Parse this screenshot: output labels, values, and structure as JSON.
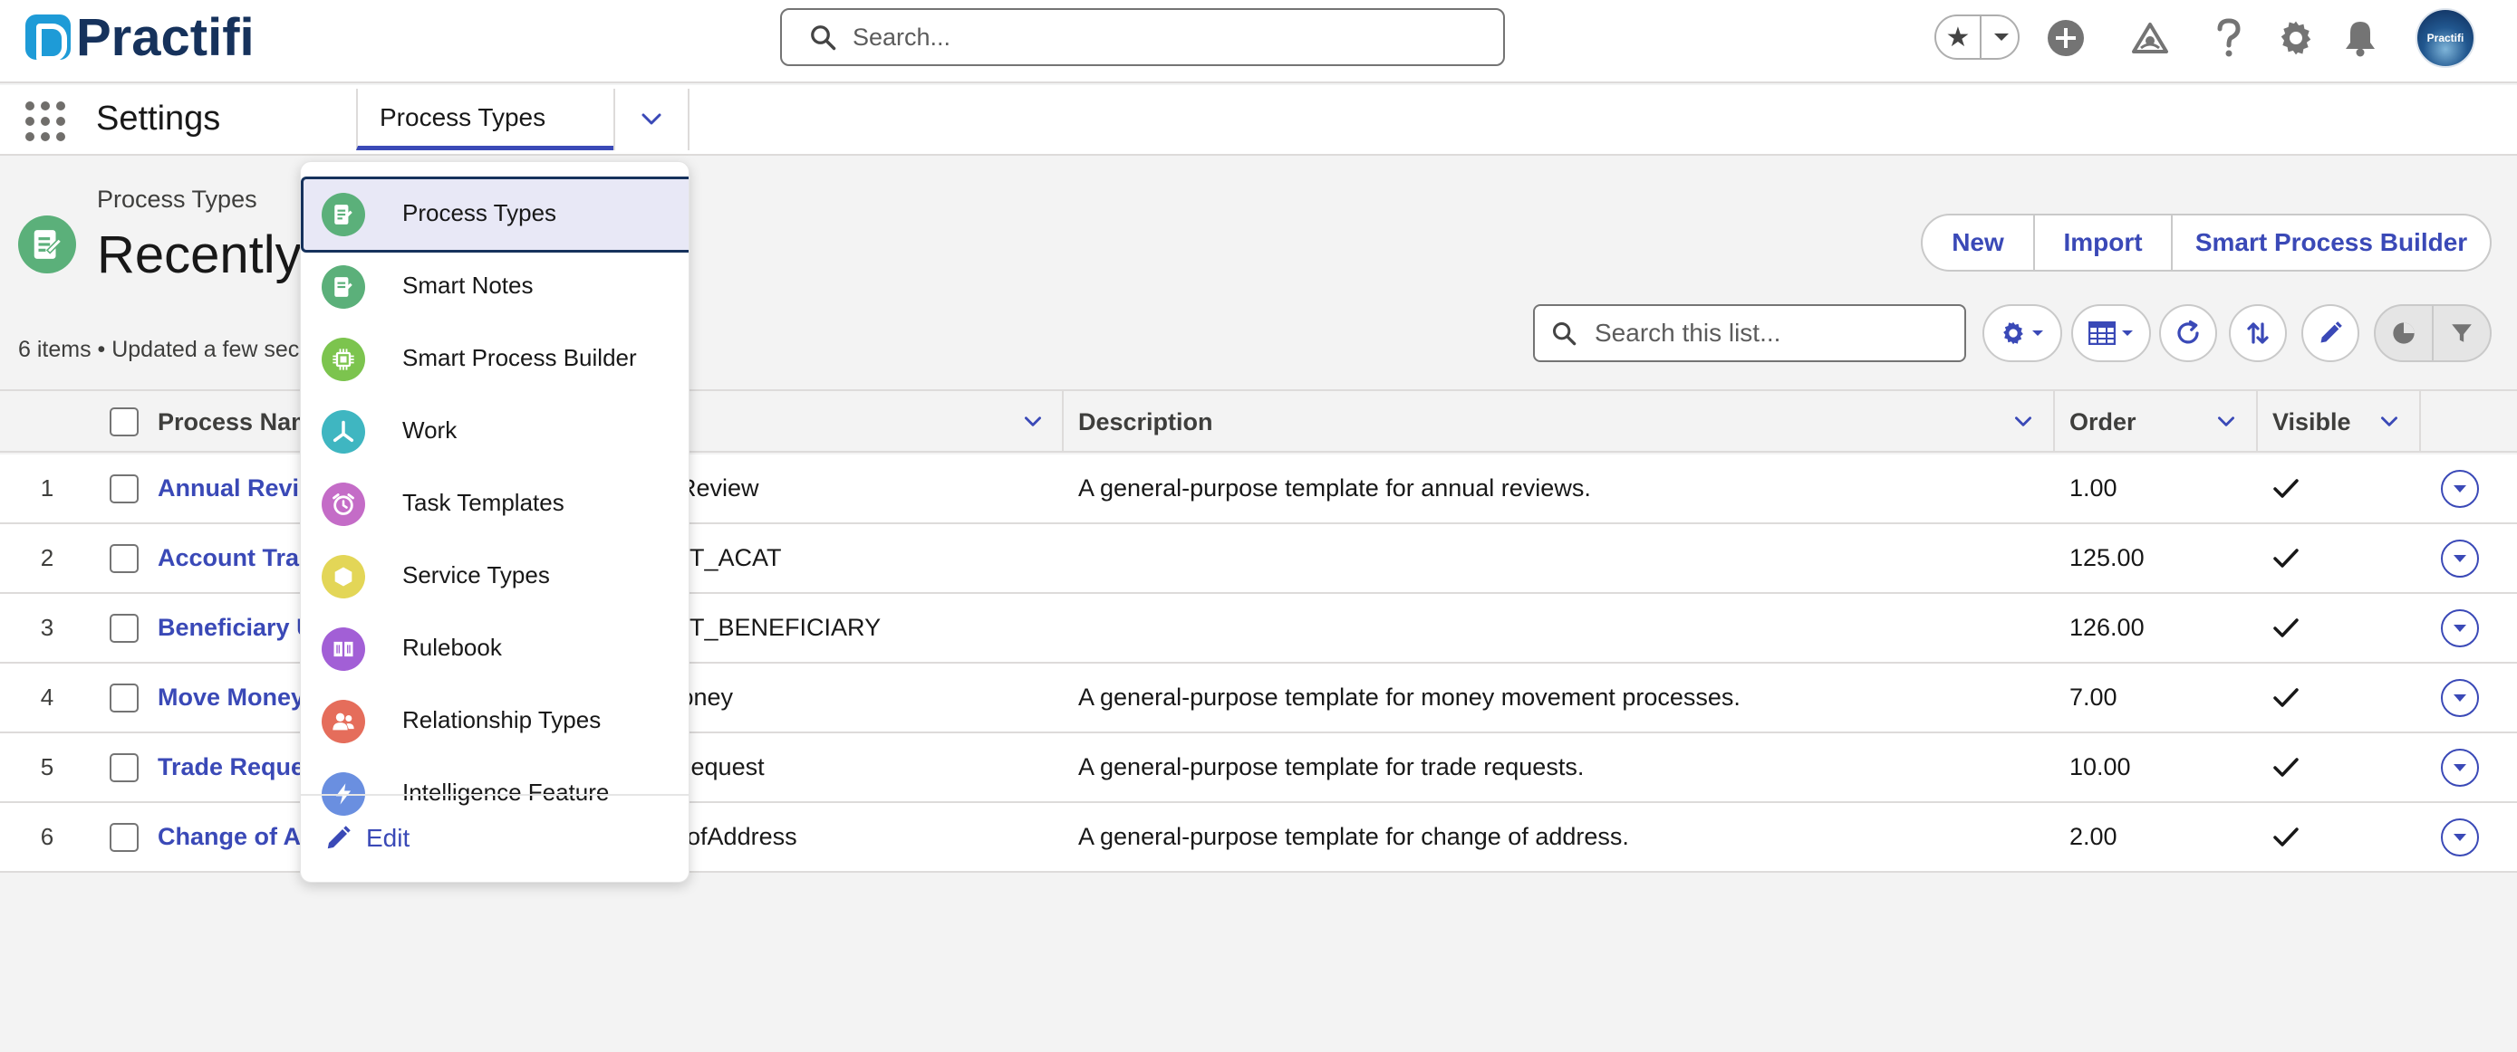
{
  "brand": {
    "name": "Practifi",
    "accent": "#3a49b7",
    "logo_color": "#1e9bd7"
  },
  "global_search": {
    "placeholder": "Search..."
  },
  "header_icons": [
    "favorites-star-icon",
    "chevron-down-icon",
    "add-icon",
    "trailhead-icon",
    "help-icon",
    "setup-gear-icon",
    "notifications-bell-icon"
  ],
  "avatar": {
    "label": "Practifi"
  },
  "nav": {
    "app_name": "Settings",
    "active_tab": "Process Types"
  },
  "dropdown": {
    "items": [
      {
        "label": "Process Types",
        "icon": "process-types-icon",
        "color": "#5bb07a",
        "selected": true
      },
      {
        "label": "Smart Notes",
        "icon": "smart-notes-icon",
        "color": "#5bb07a"
      },
      {
        "label": "Smart Process Builder",
        "icon": "chip-icon",
        "color": "#7cc44e"
      },
      {
        "label": "Work",
        "icon": "work-icon",
        "color": "#3fb6c1"
      },
      {
        "label": "Task Templates",
        "icon": "alarm-clock-icon",
        "color": "#c46cc7"
      },
      {
        "label": "Service Types",
        "icon": "hexagon-icon",
        "color": "#e3d657"
      },
      {
        "label": "Rulebook",
        "icon": "book-icon",
        "color": "#a25fd6"
      },
      {
        "label": "Relationship Types",
        "icon": "people-icon",
        "color": "#e56d5b"
      },
      {
        "label": "Intelligence Feature",
        "icon": "lightning-icon",
        "color": "#6a8fe0"
      }
    ],
    "edit_label": "Edit"
  },
  "page": {
    "object_label": "Process Types",
    "list_view_title": "Recently",
    "meta": "6 items • Updated a few sec",
    "buttons": {
      "new": "New",
      "import": "Import",
      "smart_builder": "Smart Process Builder"
    },
    "list_search_placeholder": "Search this list..."
  },
  "table": {
    "columns": {
      "name": "Process Nam",
      "api": "e",
      "description": "Description",
      "order": "Order",
      "visible": "Visible"
    },
    "rows": [
      {
        "num": "1",
        "name": "Annual Revie",
        "api": "alReview",
        "description": "A general-purpose template for annual reviews.",
        "order": "1.00",
        "visible": true
      },
      {
        "num": "2",
        "name": "Account Tran",
        "api": "_PT_ACAT",
        "description": "",
        "order": "125.00",
        "visible": true
      },
      {
        "num": "3",
        "name": "Beneficiary U",
        "api": "_PT_BENEFICIARY",
        "description": "",
        "order": "126.00",
        "visible": true
      },
      {
        "num": "4",
        "name": "Move Money",
        "api": "Money",
        "description": "A general-purpose template for money movement processes.",
        "order": "7.00",
        "visible": true
      },
      {
        "num": "5",
        "name": "Trade Reque",
        "api": "eRequest",
        "description": "A general-purpose template for trade requests.",
        "order": "10.00",
        "visible": true
      },
      {
        "num": "6",
        "name": "Change of Ac",
        "api": "geofAddress",
        "description": "A general-purpose template for change of address.",
        "order": "2.00",
        "visible": true
      }
    ]
  }
}
